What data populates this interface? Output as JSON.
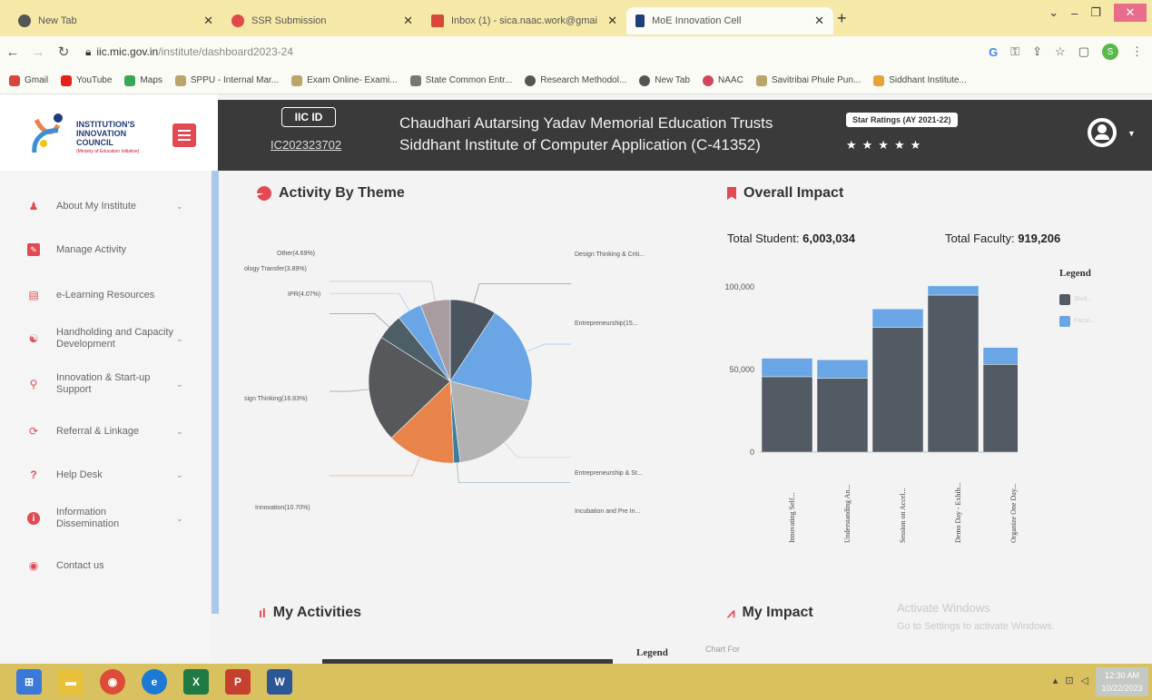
{
  "browser": {
    "tabs": [
      {
        "title": "New Tab",
        "color": "#444444"
      },
      {
        "title": "SSR Submission",
        "color": "#e04a4a"
      },
      {
        "title": "Inbox (1) - sica.naac.work@gmai",
        "color": "#d9473b"
      },
      {
        "title": "MoE Innovation Cell",
        "color": "#1f3c7a"
      }
    ],
    "url_host": "iic.mic.gov.in",
    "url_path": "/institute/dashboard2023-24",
    "bookmarks": [
      "Gmail",
      "YouTube",
      "Maps",
      "SPPU - Internal Mar...",
      "Exam Online- Exami...",
      "State Common Entr...",
      "Research Methodol...",
      "New Tab",
      "NAAC",
      "Savitribai Phule Pun...",
      "Siddhant Institute..."
    ],
    "profile_initial": "S"
  },
  "logo": {
    "line1": "INSTITUTION'S",
    "line2": "INNOVATION",
    "line3": "COUNCIL",
    "sub": "(Ministry of Education Initiative)"
  },
  "header": {
    "iic_label": "IIC ID",
    "iic_value": "IC202323702",
    "title_line1": "Chaudhari Autarsing Yadav Memorial Education Trusts",
    "title_line2": "Siddhant Institute of Computer Application (C-41352)",
    "star_label": "Star Ratings (AY 2021-22)",
    "stars": "★★★★★"
  },
  "sidebar": {
    "items": [
      {
        "label": "About My Institute",
        "icon": "user-icon",
        "color": "#e14a52",
        "caret": true
      },
      {
        "label": "Manage Activity",
        "icon": "edit-icon",
        "color": "#e14a52",
        "caret": false
      },
      {
        "label": "e-Learning Resources",
        "icon": "book-icon",
        "color": "#e14a52",
        "caret": false
      },
      {
        "label": "Handholding and Capacity Development",
        "icon": "handshake-icon",
        "color": "#e14a52",
        "caret": true
      },
      {
        "label": "Innovation & Start-up Support",
        "icon": "lightbulb-icon",
        "color": "#e14a52",
        "caret": true
      },
      {
        "label": "Referral & Linkage",
        "icon": "share-icon",
        "color": "#e14a52",
        "caret": true
      },
      {
        "label": "Help Desk",
        "icon": "question-icon",
        "color": "#e14a52",
        "caret": true
      },
      {
        "label": "Information Dissemination",
        "icon": "info-icon",
        "color": "#e14a52",
        "caret": true
      },
      {
        "label": "Contact us",
        "icon": "location-icon",
        "color": "#e14a52",
        "caret": false
      }
    ]
  },
  "theme_card": {
    "title": "Activity By Theme"
  },
  "impact_card": {
    "title": "Overall Impact",
    "students_label": "Total Student:",
    "students_value": "6,003,034",
    "faculty_label": "Total Faculty:",
    "faculty_value": "919,206",
    "legend_title": "Legend",
    "legend_items": [
      "Stud...",
      "Facul..."
    ]
  },
  "my_activities": {
    "title": "My Activities",
    "legend_title": "Legend"
  },
  "my_impact": {
    "title": "My Impact",
    "chart_for": "Chart For"
  },
  "watermark": {
    "line1": "Activate Windows",
    "line2": "Go to Settings to activate Windows."
  },
  "clock": {
    "time": "12:30 AM",
    "date": "10/22/2023"
  },
  "chart_data": [
    {
      "type": "pie",
      "title": "Activity By Theme",
      "labels": [
        "Design Thinking & Criti...",
        "Entrepreneurship(15...",
        "Entrepreneurship & St...",
        "Incubation and Pre In...",
        "Innovation(10.70%)",
        "sign Thinking(16.83%)",
        "IPR(4.07%)",
        "ology Transfer(3.89%)",
        "Other(4.69%)"
      ],
      "values": [
        7.3,
        15.6,
        15.2,
        1.0,
        10.7,
        16.83,
        4.07,
        3.89,
        4.69
      ],
      "colors": [
        "#4a5560",
        "#6aa6e6",
        "#b2b2b2",
        "#3a7fa0",
        "#e8834a",
        "#56585c",
        "#4e5e66",
        "#6aa6e6",
        "#a89ca0"
      ]
    },
    {
      "type": "bar",
      "title": "Overall Impact",
      "categories": [
        "Innovating Self...",
        "Understanding An...",
        "Session on Accel...",
        "Demo Day - Exhib...",
        "Organize One Day..."
      ],
      "series": [
        {
          "name": "Stud...",
          "values": [
            49000,
            48000,
            81000,
            102000,
            57000
          ],
          "color": "#525b63"
        },
        {
          "name": "Facul...",
          "values": [
            12000,
            12000,
            12000,
            6000,
            11000
          ],
          "color": "#6aa6e6"
        }
      ],
      "yticks": [
        "0",
        "50,000",
        "100,000"
      ],
      "ylim": [
        0,
        115000
      ],
      "legend": "right"
    }
  ]
}
